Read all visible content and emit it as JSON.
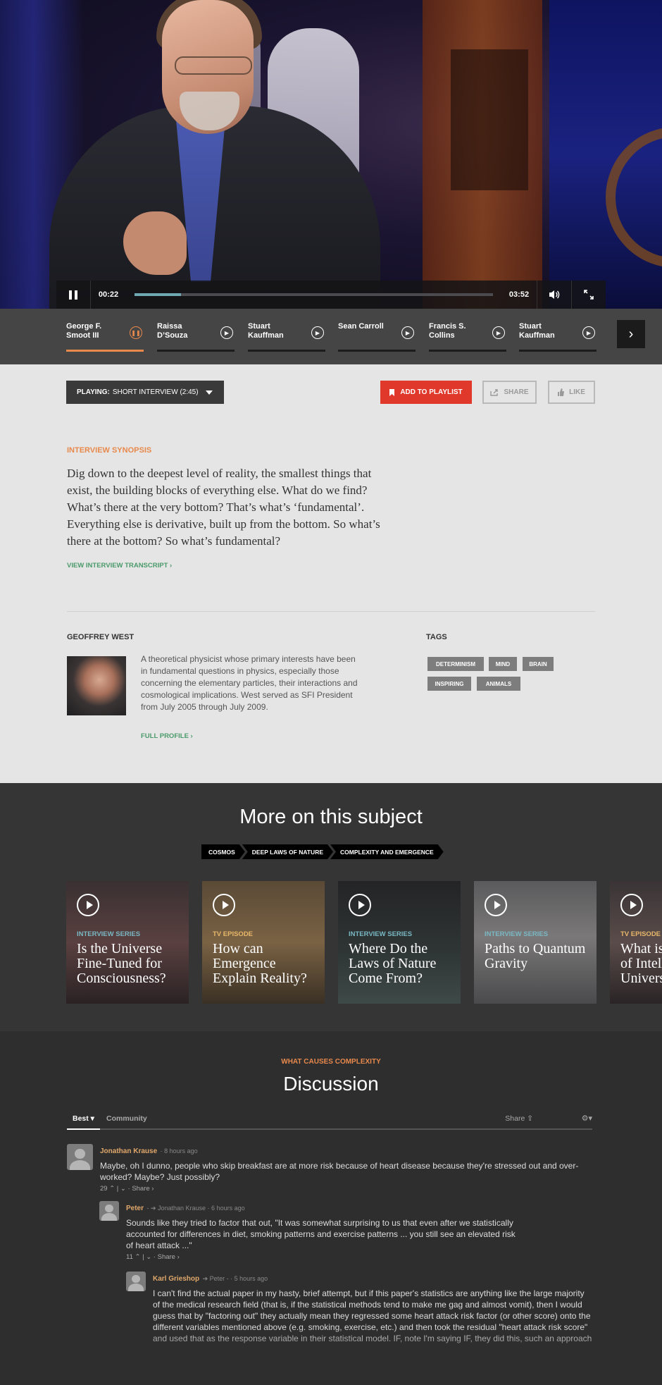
{
  "player": {
    "current_time": "00:22",
    "duration": "03:52",
    "progress_fraction": 0.13
  },
  "chapters": [
    {
      "name": "George F. Smoot III",
      "state": "playing"
    },
    {
      "name": "Raissa D’Souza",
      "state": "idle"
    },
    {
      "name": "Stuart Kauffman",
      "state": "idle"
    },
    {
      "name": "Sean Carroll",
      "state": "idle"
    },
    {
      "name": "Francis S. Collins",
      "state": "idle"
    },
    {
      "name": "Stuart Kauffman",
      "state": "idle"
    }
  ],
  "toolbar": {
    "playing_prefix": "PLAYING:",
    "playing_value": "SHORT INTERVIEW (2:45)",
    "add_to_playlist": "ADD TO PLAYLIST",
    "share": "SHARE",
    "like": "LIKE"
  },
  "synopsis": {
    "label": "INTERVIEW SYNOPSIS",
    "text": "Dig down to the deepest level of reality, the smallest things that exist, the building blocks of everything else. What do we find? What’s there at the very bottom? That’s what’s ‘fundamental’. Everything else is derivative, built up from the bottom. So what’s there at the bottom? So what’s fundamental?",
    "transcript_link": "VIEW INTERVIEW TRANSCRIPT ›"
  },
  "speaker": {
    "name": "GEOFFREY WEST",
    "bio": "A theoretical physicist whose primary interests have been in fundamental questions in physics, especially those concerning the elementary particles, their interactions and cosmological implications. West served as SFI President from July 2005 through July 2009.",
    "profile_link": "FULL PROFILE ›"
  },
  "tags": {
    "label": "TAGS",
    "items": [
      "DETERMINISM",
      "MIND",
      "BRAIN",
      "INSPIRING",
      "ANIMALS"
    ]
  },
  "more": {
    "title": "More on this subject",
    "breadcrumbs": [
      "COSMOS",
      "DEEP LAWS OF NATURE",
      "COMPLEXITY AND EMERGENCE"
    ],
    "cards": [
      {
        "kind": "INTERVIEW SERIES",
        "title": "Is the Universe Fine-Tuned for Consciousness?"
      },
      {
        "kind": "TV EPISODE",
        "title": "How can Emergence Explain Reality?"
      },
      {
        "kind": "INTERVIEW SERIES",
        "title": "Where Do the Laws of Nature Come From?"
      },
      {
        "kind": "INTERVIEW SERIES",
        "title": "Paths to Quantum Gravity"
      },
      {
        "kind": "TV EPISODE",
        "title": "What is the Future of Intelligent Universe"
      }
    ]
  },
  "discussion": {
    "kicker": "WHAT CAUSES COMPLEXITY",
    "title": "Discussion",
    "tab_best": "Best ▾",
    "tab_community": "Community",
    "share": "Share ⇪",
    "settings": "⚙▾",
    "comments": [
      {
        "author": "Jonathan Krause",
        "meta": "· 8 hours ago",
        "body": "Maybe, oh I dunno, people who skip breakfast are at more risk because of heart disease because they're stressed out and over-worked? Maybe? Just possibly?",
        "votes": "29 ⌃ | ⌄ · Share ›"
      },
      {
        "author": "Peter",
        "meta": "- ➔ Jonathan Krause · 6 hours ago",
        "body": "Sounds like they tried to factor that out, \"It was somewhat surprising to us that even after we statistically accounted for differences in diet, smoking patterns and exercise patterns ... you still see an elevated risk of heart attack ...\"",
        "votes": "11 ⌃ | ⌄ · Share ›"
      },
      {
        "author": "Karl Grieshop",
        "meta": "➔ Peter - · 5 hours ago",
        "body": "I can't find the actual paper in my hasty, brief attempt, but if this paper's statistics are anything like the large majority of the medical research field (that is, if the statistical methods tend to make me gag and almost vomit), then I would guess that by \"factoring out\" they actually mean they regressed some heart attack risk factor (or other score) onto the different variables mentioned above (e.g. smoking, exercise, etc.) and then took the residual \"heart attack risk score\" and used that as the response variable in their statistical model. IF, note I'm saying IF, they did this, such an approach"
      }
    ]
  }
}
